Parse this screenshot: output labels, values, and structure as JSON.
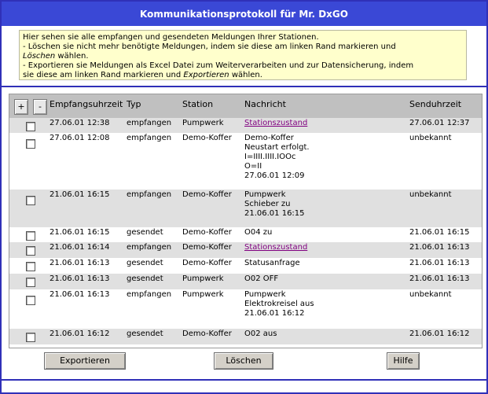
{
  "title": "Kommunikationsprotokoll für Mr. DxGO",
  "info": {
    "line1": "Hier sehen sie alle empfangen und gesendeten Meldungen Ihrer Stationen.",
    "line2": "- Löschen sie nicht mehr benötigte Meldungen, indem sie diese am linken Rand markieren und",
    "line3_em": "Löschen",
    "line3_rest": " wählen.",
    "line4": "- Exportieren sie Meldungen als Excel Datei zum Weiterverarbeiten und zur Datensicherung, indem",
    "line5_pre": "sie diese am linken Rand markieren und ",
    "line5_em": "Exportieren",
    "line5_rest": " wählen."
  },
  "table": {
    "plus_label": "+",
    "minus_label": "-",
    "headers": {
      "empfang": "Empfangsuhrzeit",
      "typ": "Typ",
      "station": "Station",
      "nachricht": "Nachricht",
      "sende": "Senduhrzeit"
    },
    "rows": [
      {
        "empfang": "27.06.01 12:38",
        "typ": "empfangen",
        "station": "Pumpwerk",
        "nachricht": "Stationszustand",
        "link": true,
        "sende": "27.06.01 12:37"
      },
      {
        "empfang": "27.06.01 12:08",
        "typ": "empfangen",
        "station": "Demo-Koffer",
        "nachricht": "Demo-Koffer\nNeustart erfolgt.\nI=IIII.IIII.IOOc\nO=II\n27.06.01 12:09",
        "link": false,
        "sende": "unbekannt"
      },
      {
        "empfang": "21.06.01 16:15",
        "typ": "empfangen",
        "station": "Demo-Koffer",
        "nachricht": "Pumpwerk\nSchieber zu\n21.06.01 16:15",
        "link": false,
        "sende": "unbekannt"
      },
      {
        "empfang": "21.06.01 16:15",
        "typ": "gesendet",
        "station": "Demo-Koffer",
        "nachricht": "O04 zu",
        "link": false,
        "sende": "21.06.01 16:15"
      },
      {
        "empfang": "21.06.01 16:14",
        "typ": "empfangen",
        "station": "Demo-Koffer",
        "nachricht": "Stationszustand",
        "link": true,
        "sende": "21.06.01 16:13"
      },
      {
        "empfang": "21.06.01 16:13",
        "typ": "gesendet",
        "station": "Demo-Koffer",
        "nachricht": "Statusanfrage",
        "link": false,
        "sende": "21.06.01 16:13"
      },
      {
        "empfang": "21.06.01 16:13",
        "typ": "gesendet",
        "station": "Pumpwerk",
        "nachricht": "O02 OFF",
        "link": false,
        "sende": "21.06.01 16:13"
      },
      {
        "empfang": "21.06.01 16:13",
        "typ": "empfangen",
        "station": "Pumpwerk",
        "nachricht": "Pumpwerk\nElektrokreisel aus\n21.06.01 16:12",
        "link": false,
        "sende": "unbekannt"
      },
      {
        "empfang": "21.06.01 16:12",
        "typ": "gesendet",
        "station": "Demo-Koffer",
        "nachricht": "O02 aus",
        "link": false,
        "sende": "21.06.01 16:12"
      }
    ]
  },
  "buttons": {
    "export": "Exportieren",
    "delete": "Löschen",
    "help": "Hilfe"
  }
}
